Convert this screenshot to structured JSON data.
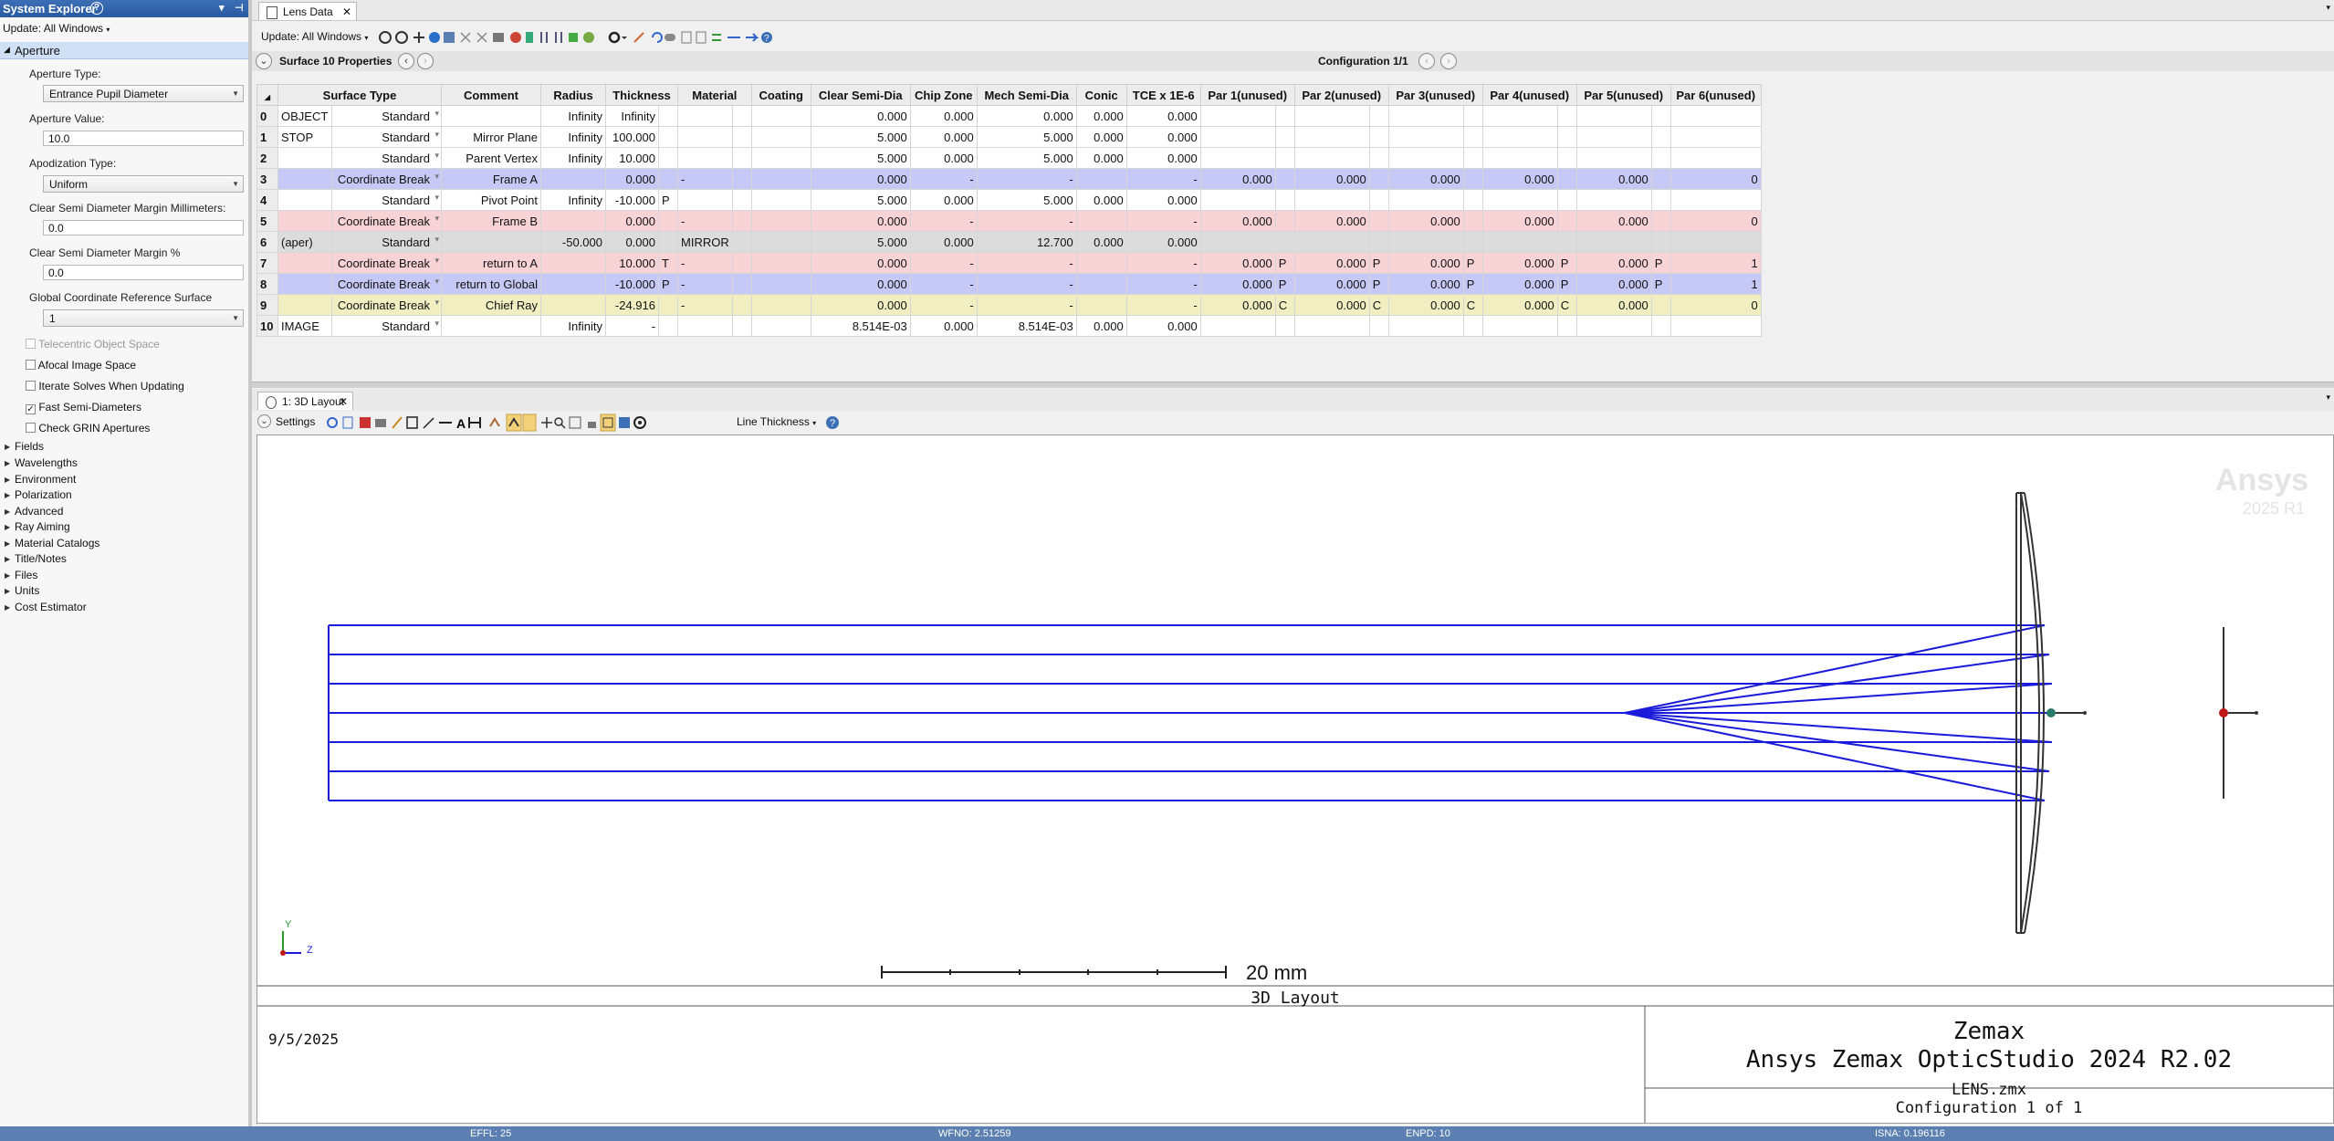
{
  "sidebar": {
    "title": "System Explorer",
    "update_label": "Update: All Windows",
    "aperture_header": "Aperture",
    "aperture_type_label": "Aperture Type:",
    "aperture_type_value": "Entrance Pupil Diameter",
    "aperture_value_label": "Aperture Value:",
    "aperture_value": "10.0",
    "apodization_label": "Apodization Type:",
    "apodization_value": "Uniform",
    "clear_mm_label": "Clear Semi Diameter Margin Millimeters:",
    "clear_mm_value": "0.0",
    "clear_pct_label": "Clear Semi Diameter Margin %",
    "clear_pct_value": "0.0",
    "gcrs_label": "Global Coordinate Reference Surface",
    "gcrs_value": "1",
    "checkboxes": [
      {
        "label": "Telecentric Object Space",
        "checked": false,
        "disabled": true
      },
      {
        "label": "Afocal Image Space",
        "checked": false,
        "disabled": false
      },
      {
        "label": "Iterate Solves When Updating",
        "checked": false,
        "disabled": false
      },
      {
        "label": "Fast Semi-Diameters",
        "checked": true,
        "disabled": false
      },
      {
        "label": "Check GRIN Apertures",
        "checked": false,
        "disabled": false
      }
    ],
    "groups": [
      "Fields",
      "Wavelengths",
      "Environment",
      "Polarization",
      "Advanced",
      "Ray Aiming",
      "Material Catalogs",
      "Title/Notes",
      "Files",
      "Units",
      "Cost Estimator"
    ]
  },
  "lens_tab": {
    "label": "Lens Data"
  },
  "lens_toolbar": {
    "update_label": "Update: All Windows"
  },
  "conf_bar": {
    "surface_label": "Surface  10 Properties",
    "configuration": "Configuration 1/1"
  },
  "table": {
    "headers": [
      "",
      "Surface Type",
      "",
      "Comment",
      "Radius",
      "Thickness",
      "",
      "Material",
      "",
      "Coating",
      "Clear Semi-Dia",
      "Chip Zone",
      "Mech Semi-Dia",
      "Conic",
      "TCE x 1E-6",
      "Par 1(unused)",
      "",
      "Par 2(unused)",
      "",
      "Par 3(unused)",
      "",
      "Par 4(unused)",
      "",
      "Par 5(unused)",
      "",
      "Par 6(unused)"
    ],
    "rows": [
      {
        "num": "0",
        "name": "OBJECT",
        "type": "Standard",
        "comment": "",
        "radius": "Infinity",
        "thickness": "Infinity",
        "tflag": "",
        "material": "",
        "mflag": "",
        "coating": "",
        "clear": "0.000",
        "chip": "0.000",
        "mech": "0.000",
        "conic": "0.000",
        "tce": "0.000",
        "pars": [
          "",
          "",
          "",
          "",
          "",
          ""
        ],
        "pflags": [
          "",
          "",
          "",
          "",
          "",
          ""
        ],
        "style": "white"
      },
      {
        "num": "1",
        "name": "STOP",
        "type": "Standard",
        "comment": "Mirror Plane",
        "radius": "Infinity",
        "thickness": "100.000",
        "tflag": "",
        "material": "",
        "mflag": "",
        "coating": "",
        "clear": "5.000",
        "chip": "0.000",
        "mech": "5.000",
        "conic": "0.000",
        "tce": "0.000",
        "pars": [
          "",
          "",
          "",
          "",
          "",
          ""
        ],
        "pflags": [
          "",
          "",
          "",
          "",
          "",
          ""
        ],
        "style": "white"
      },
      {
        "num": "2",
        "name": "",
        "type": "Standard",
        "comment": "Parent Vertex",
        "radius": "Infinity",
        "thickness": "10.000",
        "tflag": "",
        "material": "",
        "mflag": "",
        "coating": "",
        "clear": "5.000",
        "chip": "0.000",
        "mech": "5.000",
        "conic": "0.000",
        "tce": "0.000",
        "pars": [
          "",
          "",
          "",
          "",
          "",
          ""
        ],
        "pflags": [
          "",
          "",
          "",
          "",
          "",
          ""
        ],
        "style": "white"
      },
      {
        "num": "3",
        "name": "",
        "type": "Coordinate Break",
        "comment": "Frame A",
        "radius": "",
        "thickness": "0.000",
        "tflag": "",
        "material": "-",
        "mflag": "",
        "coating": "",
        "clear": "0.000",
        "chip": "-",
        "mech": "-",
        "conic": "",
        "tce": "-",
        "pars": [
          "0.000",
          "0.000",
          "0.000",
          "0.000",
          "0.000",
          "0"
        ],
        "pflags": [
          "",
          "",
          "",
          "",
          "",
          ""
        ],
        "style": "blue"
      },
      {
        "num": "4",
        "name": "",
        "type": "Standard",
        "comment": "Pivot Point",
        "radius": "Infinity",
        "thickness": "-10.000",
        "tflag": "P",
        "material": "",
        "mflag": "",
        "coating": "",
        "clear": "5.000",
        "chip": "0.000",
        "mech": "5.000",
        "conic": "0.000",
        "tce": "0.000",
        "pars": [
          "",
          "",
          "",
          "",
          "",
          ""
        ],
        "pflags": [
          "",
          "",
          "",
          "",
          "",
          ""
        ],
        "style": "white"
      },
      {
        "num": "5",
        "name": "",
        "type": "Coordinate Break",
        "comment": "Frame B",
        "radius": "",
        "thickness": "0.000",
        "tflag": "",
        "material": "-",
        "mflag": "",
        "coating": "",
        "clear": "0.000",
        "chip": "-",
        "mech": "-",
        "conic": "",
        "tce": "-",
        "pars": [
          "0.000",
          "0.000",
          "0.000",
          "0.000",
          "0.000",
          "0"
        ],
        "pflags": [
          "",
          "",
          "",
          "",
          "",
          ""
        ],
        "style": "pink"
      },
      {
        "num": "6",
        "name": "(aper)",
        "type": "Standard",
        "comment": "",
        "radius": "-50.000",
        "thickness": "0.000",
        "tflag": "",
        "material": "MIRROR",
        "mflag": "",
        "coating": "",
        "clear": "5.000",
        "chip": "0.000",
        "mech": "12.700",
        "conic": "0.000",
        "tce": "0.000",
        "pars": [
          "",
          "",
          "",
          "",
          "",
          ""
        ],
        "pflags": [
          "",
          "",
          "",
          "",
          "",
          ""
        ],
        "style": "gray"
      },
      {
        "num": "7",
        "name": "",
        "type": "Coordinate Break",
        "comment": "return to A",
        "radius": "",
        "thickness": "10.000",
        "tflag": "T",
        "material": "-",
        "mflag": "",
        "coating": "",
        "clear": "0.000",
        "chip": "-",
        "mech": "-",
        "conic": "",
        "tce": "-",
        "pars": [
          "0.000",
          "0.000",
          "0.000",
          "0.000",
          "0.000",
          "1"
        ],
        "pflags": [
          "P",
          "P",
          "P",
          "P",
          "P",
          ""
        ],
        "style": "pink"
      },
      {
        "num": "8",
        "name": "",
        "type": "Coordinate Break",
        "comment": "return to Global",
        "radius": "",
        "thickness": "-10.000",
        "tflag": "P",
        "material": "-",
        "mflag": "",
        "coating": "",
        "clear": "0.000",
        "chip": "-",
        "mech": "-",
        "conic": "",
        "tce": "-",
        "pars": [
          "0.000",
          "0.000",
          "0.000",
          "0.000",
          "0.000",
          "1"
        ],
        "pflags": [
          "P",
          "P",
          "P",
          "P",
          "P",
          ""
        ],
        "style": "blue"
      },
      {
        "num": "9",
        "name": "",
        "type": "Coordinate Break",
        "comment": "Chief Ray",
        "radius": "",
        "thickness": "-24.916",
        "tflag": "",
        "material": "-",
        "mflag": "",
        "coating": "",
        "clear": "0.000",
        "chip": "-",
        "mech": "-",
        "conic": "",
        "tce": "-",
        "pars": [
          "0.000",
          "0.000",
          "0.000",
          "0.000",
          "0.000",
          "0"
        ],
        "pflags": [
          "C",
          "C",
          "C",
          "C",
          "",
          ""
        ],
        "style": "yellow"
      },
      {
        "num": "10",
        "name": "IMAGE",
        "type": "Standard",
        "comment": "",
        "radius": "Infinity",
        "thickness": "-",
        "tflag": "",
        "material": "",
        "mflag": "",
        "coating": "",
        "clear": "8.514E-03",
        "chip": "0.000",
        "mech": "8.514E-03",
        "conic": "0.000",
        "tce": "0.000",
        "pars": [
          "",
          "",
          "",
          "",
          "",
          ""
        ],
        "pflags": [
          "",
          "",
          "",
          "",
          "",
          ""
        ],
        "style": "sel"
      }
    ]
  },
  "layout_tab": {
    "label": "1: 3D Layout"
  },
  "layout_toolbar": {
    "settings": "Settings",
    "line_thickness": "Line Thickness"
  },
  "layout": {
    "watermark_brand": "Ansys",
    "watermark_version": "2025 R1",
    "scale_label": "20 mm",
    "plot_title": "3D Layout",
    "date": "9/5/2025",
    "vendor": "Zemax",
    "product": "Ansys Zemax OpticStudio 2024 R2.02",
    "file": "LENS.zmx",
    "config": "Configuration 1 of 1",
    "axis_y": "Y",
    "axis_z": "Z",
    "ray_color": "#1a1adb"
  },
  "status": {
    "effl": "EFFL: 25",
    "wfno": "WFNO: 2.51259",
    "enpd": "ENPD: 10",
    "isna": "ISNA: 0.196116"
  }
}
